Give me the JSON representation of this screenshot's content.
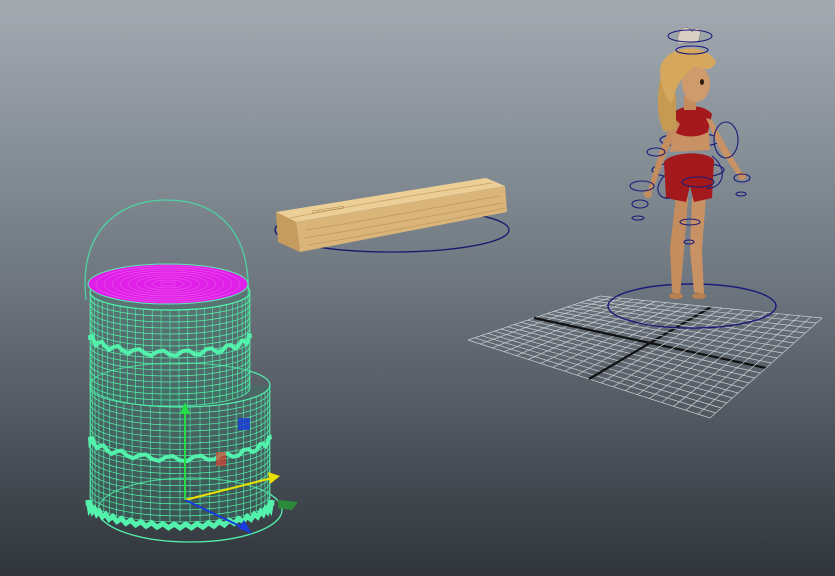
{
  "viewport": {
    "background_top": "#a3aab1",
    "background_bottom": "#30353b"
  },
  "objects": {
    "cake": {
      "wireframe_color": "#53f2ac",
      "top_color": "#e020e8",
      "selected": true
    },
    "plank": {
      "wood_light": "#e6c489",
      "wood_dark": "#b88d52"
    },
    "character": {
      "skin": "#c99264",
      "hair": "#d4a55c",
      "outfit": "#a3191c",
      "control_color": "#1a1a7a"
    },
    "ground_grid": {
      "line_color": "#c9ced3",
      "axis_color": "#111111"
    }
  },
  "manipulator": {
    "x_axis_color": "#e8e000",
    "y_axis_color": "#22dd44",
    "z_axis_color": "#1a3bdc"
  }
}
